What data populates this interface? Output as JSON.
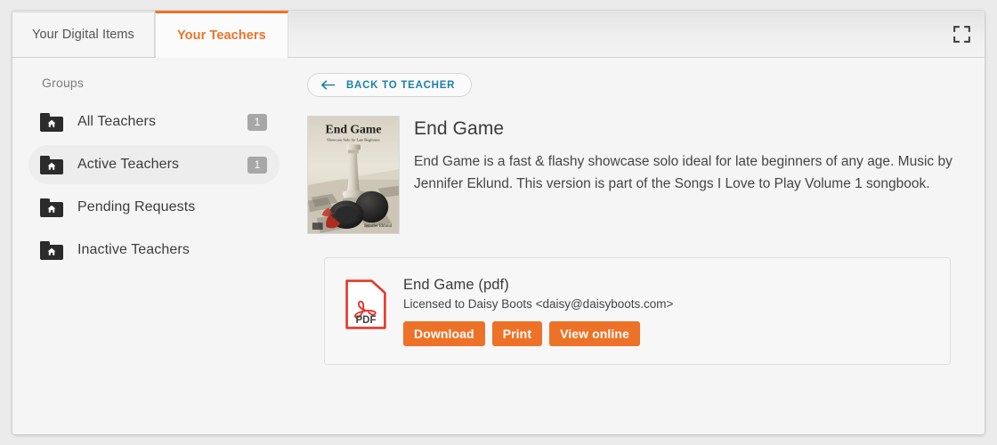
{
  "window": {
    "tabs": [
      {
        "label": "Your Digital Items",
        "active": false
      },
      {
        "label": "Your Teachers",
        "active": true
      }
    ],
    "fullscreen_icon": "fullscreen-expand-icon"
  },
  "sidebar": {
    "heading": "Groups",
    "items": [
      {
        "label": "All Teachers",
        "badge": "1",
        "icon": "folder-home-icon",
        "selected": false
      },
      {
        "label": "Active Teachers",
        "badge": "1",
        "icon": "folder-home-icon",
        "selected": true
      },
      {
        "label": "Pending Requests",
        "badge": "",
        "icon": "folder-home-icon",
        "selected": false
      },
      {
        "label": "Inactive Teachers",
        "badge": "",
        "icon": "folder-home-icon",
        "selected": false
      }
    ]
  },
  "main": {
    "back_button": {
      "label": "BACK TO TEACHER",
      "icon": "arrow-left-icon"
    },
    "item": {
      "title": "End Game",
      "description": "End Game is a fast & flashy showcase solo ideal for late beginners of any age. Music by Jennifer Eklund. This version is part of the Songs I Love to Play Volume 1 songbook.",
      "cover": {
        "title_text": "End Game",
        "subtitle_text": "Showcase Solo for Late Beginners",
        "composer_text": "Jennifer Eklund"
      }
    },
    "file_card": {
      "icon": "pdf-file-icon",
      "icon_label": "PDF",
      "title": "End Game (pdf)",
      "license": "Licensed to Daisy Boots <daisy@daisyboots.com>",
      "actions": [
        {
          "label": "Download"
        },
        {
          "label": "Print"
        },
        {
          "label": "View online"
        }
      ]
    }
  },
  "colors": {
    "accent_orange": "#ed7228",
    "link_teal": "#1a81a8",
    "badge_gray": "#a7a7a7",
    "page_bg": "#ebebeb",
    "panel_bg": "#f5f5f5"
  }
}
